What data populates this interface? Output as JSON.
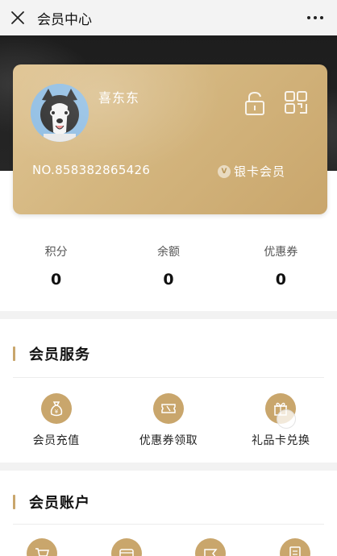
{
  "header": {
    "title": "会员中心"
  },
  "card": {
    "username": "喜东东",
    "card_number": "NO.858382865426",
    "level": "银卡会员",
    "level_badge": "V"
  },
  "stats": [
    {
      "label": "积分",
      "value": "0"
    },
    {
      "label": "余额",
      "value": "0"
    },
    {
      "label": "优惠券",
      "value": "0"
    }
  ],
  "services_section": {
    "title": "会员服务",
    "items": [
      {
        "label": "会员充值",
        "icon": "money-bag-icon"
      },
      {
        "label": "优惠券领取",
        "icon": "coupon-icon"
      },
      {
        "label": "礼品卡兑换",
        "icon": "gift-card-icon"
      }
    ]
  },
  "account_section": {
    "title": "会员账户",
    "items": [
      {
        "icon": "cart-icon"
      },
      {
        "icon": "wallet-icon"
      },
      {
        "icon": "ticket-icon"
      },
      {
        "icon": "document-icon"
      }
    ]
  },
  "colors": {
    "gold": "#c9a66c",
    "dark_band": "#222222"
  }
}
